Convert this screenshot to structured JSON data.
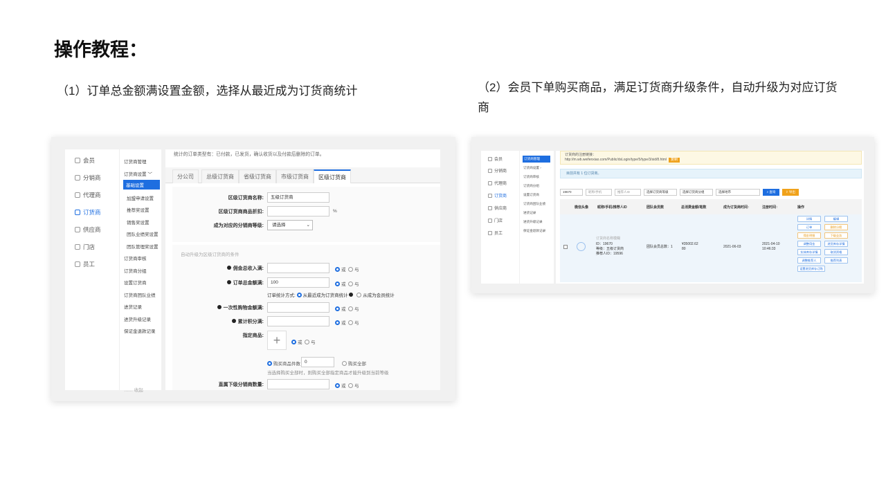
{
  "title": "操作教程：",
  "captions": {
    "left": "（1）订单总金额满设置金额，选择从最近成为订货商统计",
    "right": "（2）会员下单购买商品，满足订货商升级条件，自动升级为对应订货商"
  },
  "shot1": {
    "nav": [
      "会员",
      "分销商",
      "代理商",
      "订货商",
      "供应商",
      "门店",
      "员工"
    ],
    "sub": {
      "items": [
        "订货商管理",
        "订货商设置",
        "基础设置",
        "加盟申请设置",
        "推荐奖设置",
        "销售奖设置",
        "团队业绩奖设置",
        "团队管理奖设置",
        "订货商审核",
        "订货商分组",
        "设置订货商",
        "订货商团队业绩",
        "进货记录",
        "进货升级记录",
        "保证金退款记录"
      ],
      "footer": "…… 收起"
    },
    "note": "统计的订单类型有：已付款，已发货，确认收货以及付款后删除的订单。",
    "tabs": [
      "分公司",
      "总级订货商",
      "省级订货商",
      "市级订货商",
      "区级订货商"
    ],
    "form": {
      "name_label": "区级订货商名称:",
      "name_value": "五级订货商",
      "discount_label": "区级订货商商品折扣:",
      "discount_unit": "%",
      "level_label": "成为对应的分销商等级:",
      "level_value": "请选择",
      "section_title": "自动升级为区级订货商的条件",
      "c1_label": "佣金总收入满:",
      "c2_label": "订单总金额满:",
      "c2_value": "100",
      "stat_label": "订单统计方式:",
      "stat_opt1": "从最近成为订货商统计",
      "stat_opt2": "从成为会员统计",
      "c3_label": "一次性购物金额满:",
      "c4_label": "累计积分满:",
      "goods_label": "指定商品:",
      "buy_count_label": "购买商品件数",
      "buy_count_value": "0",
      "buy_all_label": "购买全部",
      "hint": "当选择购买全部时，则购买全部指定商品才能升级到当前等级",
      "c5_label": "直属下级分销商数量:",
      "or": "或",
      "and": "与"
    }
  },
  "shot2": {
    "nav": [
      "会员",
      "分销商",
      "代理商",
      "订货商",
      "供应商",
      "门店",
      "员工"
    ],
    "sub": [
      "订货商管理",
      "订货商设置",
      "订货商审核",
      "订货商分组",
      "设置订货商",
      "订货商团队业绩",
      "进货记录",
      "进货升级记录",
      "保证金退款记录"
    ],
    "banner_text": "订货商的注册链接：",
    "banner_url": "http://m.wb.weifenxiao.com/Public/dsLogin/type/5/type/3/sid/8.html",
    "banner_btn": "复制",
    "info": "目前共有 1 位订货商。",
    "filters": [
      "19670",
      "昵称/手机",
      "推荐人ID",
      "选择订货商等级",
      "选择订货商分组",
      "选择地市"
    ],
    "search_btn": "查询",
    "export_btn": "导出",
    "headers": [
      "微信头像",
      "昵称/手机/推荐人ID",
      "团队会员数",
      "总消费金额/笔数",
      "成为订货商时间↑",
      "注册时间↑",
      "操作"
    ],
    "row": {
      "nick": "订货商名称模糊",
      "id": "ID：19670",
      "level": "等级：五级订货商",
      "referrer": "推荐人ID：19596",
      "team": "团队会员总数：1",
      "total": "¥35002.62",
      "orders": "80",
      "become_date": "2021-06-03",
      "reg_date": "2021-04-10",
      "reg_time": "10:46:33"
    },
    "ops": [
      "详情",
      "编辑",
      "订单",
      "删除分佣",
      "佣金明细",
      "下级业务",
      "调整用金",
      "进货库存详情",
      "实体库存详情",
      "取消资格",
      "调整推荐人",
      "推荐列表",
      "设置进货库存订购"
    ],
    "colors": {
      "accent": "#1e6ee0",
      "warn": "#f0a21b"
    }
  }
}
